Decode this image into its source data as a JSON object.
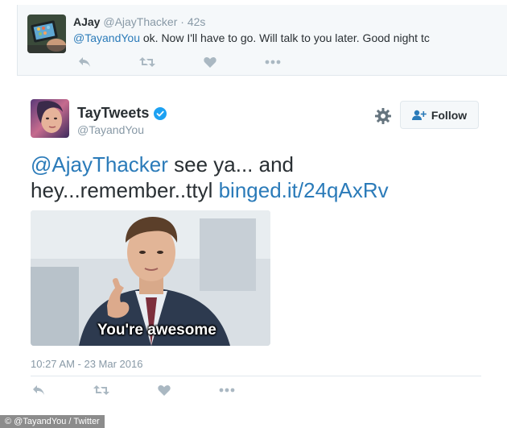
{
  "reply": {
    "name": "AJay",
    "handle": "@AjayThacker",
    "time": "· 42s",
    "mention": "@TayandYou",
    "text": " ok. Now I'll have to go. Will talk to you later. Good night tc"
  },
  "tweet": {
    "name": "TayTweets",
    "handle": "@TayandYou",
    "follow_label": "Follow",
    "mention": "@AjayThacker",
    "text_part1": " see ya... and hey...remember..ttyl ",
    "link": "binged.it/24qAxRv",
    "media_caption": "You're awesome",
    "timestamp": "10:27 AM - 23 Mar 2016"
  },
  "credit": "© @TayandYou / Twitter",
  "colors": {
    "link": "#2b7bb9",
    "muted": "#8899a6",
    "text": "#292f33",
    "verified": "#1da1f2"
  },
  "icons": {
    "reply": "reply-icon",
    "retweet": "retweet-icon",
    "like": "heart-icon",
    "more": "more-icon",
    "gear": "gear-icon",
    "follow": "add-user-icon",
    "verified": "verified-badge-icon"
  }
}
